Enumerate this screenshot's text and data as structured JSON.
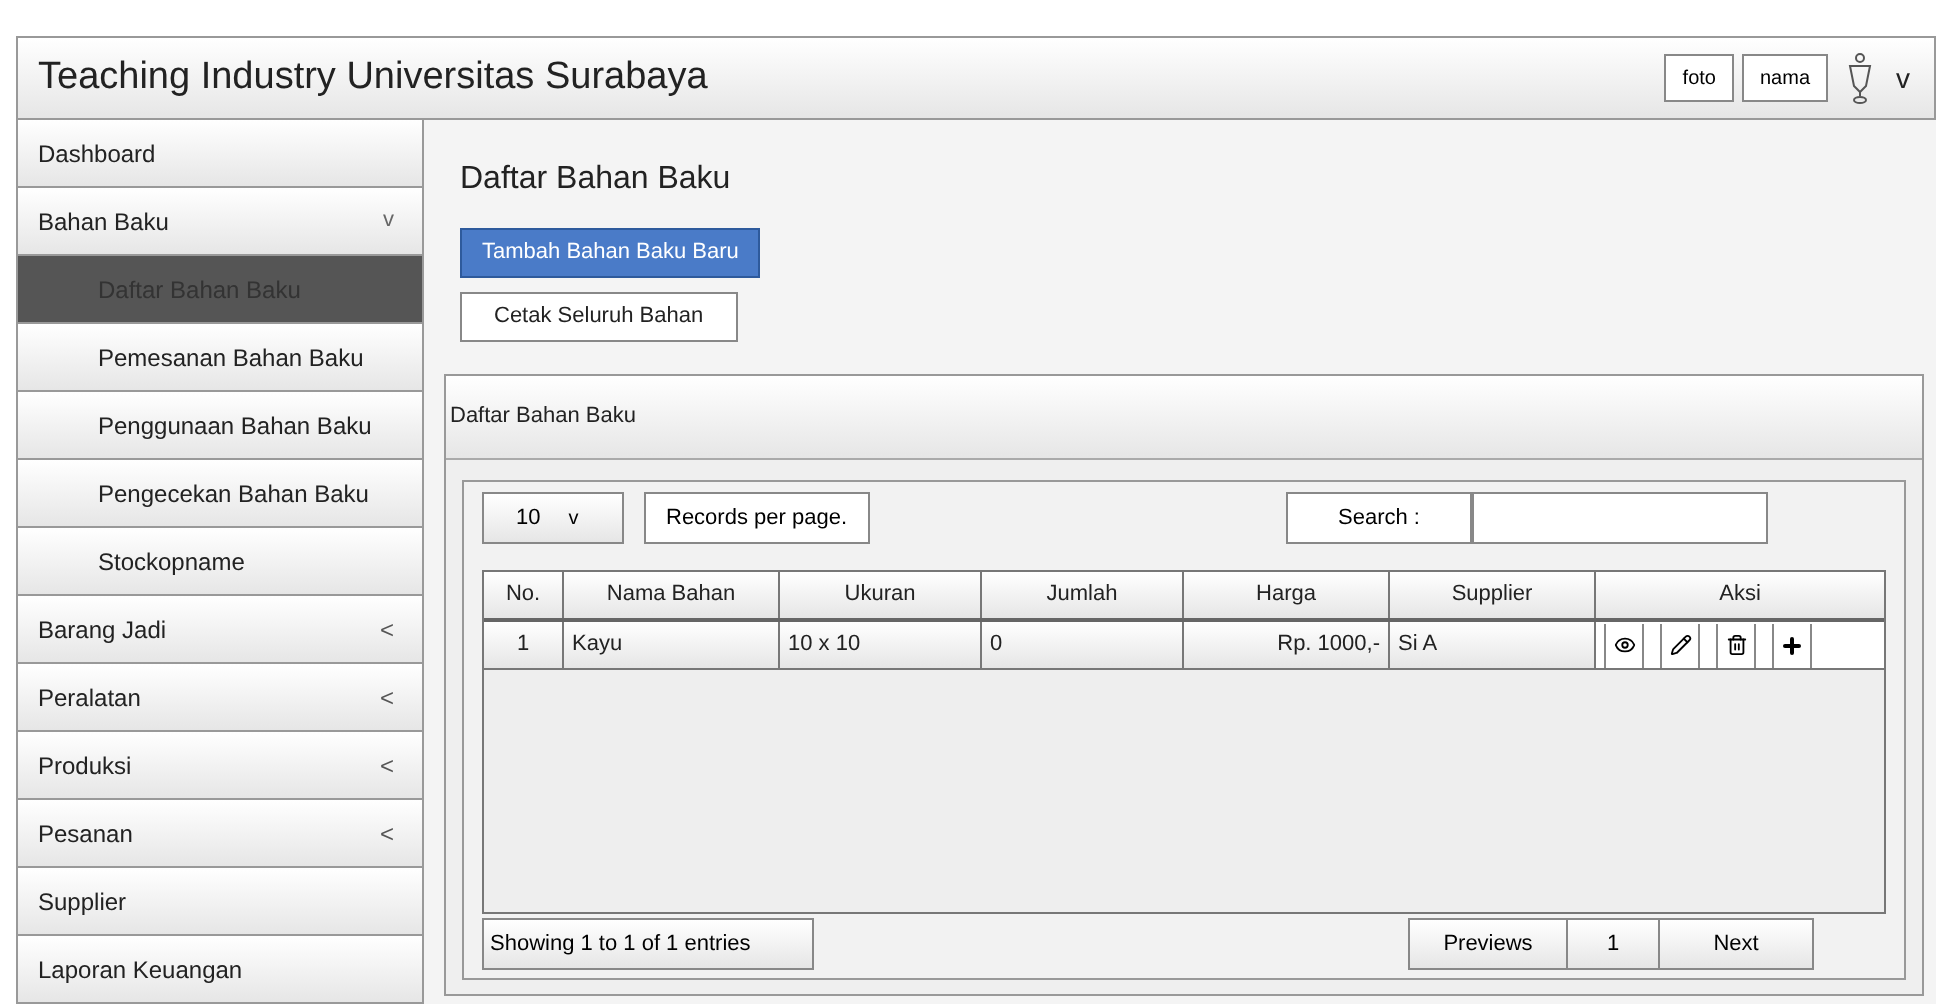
{
  "header": {
    "title": "Teaching Industry Universitas Surabaya",
    "photo_label": "foto",
    "name_label": "nama",
    "menu_caret": "v"
  },
  "sidebar": {
    "items": [
      {
        "label": "Dashboard",
        "selected": false
      },
      {
        "label": "Bahan Baku",
        "caret": "v",
        "expanded": true,
        "children": [
          {
            "label": "Daftar Bahan Baku",
            "selected": true
          },
          {
            "label": "Pemesanan Bahan Baku",
            "selected": false
          },
          {
            "label": "Penggunaan Bahan Baku",
            "selected": false
          },
          {
            "label": "Pengecekan Bahan Baku",
            "selected": false
          },
          {
            "label": "Stockopname",
            "selected": false
          }
        ]
      },
      {
        "label": "Barang Jadi",
        "caret": "<",
        "expanded": false
      },
      {
        "label": "Peralatan",
        "caret": "<",
        "expanded": false
      },
      {
        "label": "Produksi",
        "caret": "<",
        "expanded": false
      },
      {
        "label": "Pesanan",
        "caret": "<",
        "expanded": false
      },
      {
        "label": "Supplier",
        "selected": false
      },
      {
        "label": "Laporan Keuangan",
        "selected": false
      }
    ]
  },
  "page_title": "Daftar Bahan Baku",
  "buttons": [
    {
      "label": "Tambah Bahan Baku Baru",
      "kind": "primary"
    },
    {
      "label": "Cetak Seluruh Bahan",
      "kind": "default"
    }
  ],
  "panel": {
    "title": "Daftar Bahan Baku",
    "page_size": {
      "value": "10",
      "caret": "v"
    },
    "page_size_label": "Records per page.",
    "search_label": "Search :",
    "table": {
      "columns": [
        "No.",
        "Nama Bahan",
        "Ukuran",
        "Jumlah",
        "Harga",
        "Supplier",
        "Aksi"
      ],
      "rows": [
        {
          "cells": [
            "1",
            "Kayu",
            "10 x 10",
            "0",
            "Rp. 1000,-",
            "Si A"
          ],
          "actions": [
            {
              "kind": "view"
            },
            {
              "kind": "edit"
            },
            {
              "kind": "delete"
            },
            {
              "kind": "add"
            }
          ]
        }
      ]
    },
    "info": "Showing 1 to 1 of 1 entries",
    "pagination": {
      "previous": "Previews",
      "pages": [
        {
          "label": "1",
          "selected": false
        }
      ],
      "next": "Next"
    }
  }
}
